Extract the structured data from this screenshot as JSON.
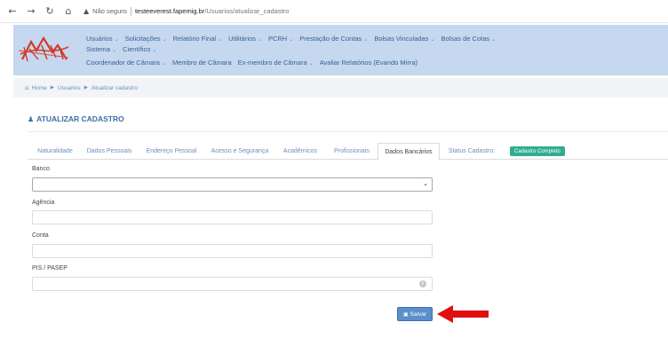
{
  "browser": {
    "back": "←",
    "forward": "→",
    "reload": "↻",
    "home": "⌂",
    "warning": "▲",
    "security_label": "Não seguro",
    "url_host": "testeeverest.fapemig.br",
    "url_path": "/Usuarios/atualizar_cadastro"
  },
  "menu": {
    "row1": [
      "Usuários",
      "Solicitações",
      "Relatório Final",
      "Utilitários",
      "PCRH",
      "Prestação de Contas",
      "Bolsas Vinculadas",
      "Bolsas de Cotas"
    ],
    "row2": [
      "Sistema",
      "Científico"
    ],
    "row3": [
      "Coordenador de Câmara",
      "Membro de Câmara",
      "Ex-membro de Câmara",
      "Avaliar Relatórios (Evando Mirra)"
    ],
    "chevron": "⌄"
  },
  "breadcrumb": {
    "home": "Home",
    "usuarios": "Usuarios",
    "current": "Atualizar cadastro",
    "sep": "▶"
  },
  "page": {
    "title": "ATUALIZAR CADASTRO"
  },
  "tabs": {
    "naturalidade": "Naturalidade",
    "dados_pessoais": "Dados Pessoais",
    "endereco": "Endereço Pessoal",
    "acesso": "Acesso e Segurança",
    "academicos": "Acadêmicos",
    "profissionais": "Profissionais",
    "bancarios": "Dados Bancários",
    "status": "Status Cadastro:",
    "badge": "Cadastro Completo"
  },
  "form": {
    "banco_label": "Banco",
    "agencia_label": "Agência",
    "conta_label": "Conta",
    "pis_label": "PIS / PASEP",
    "select_chevron": "⌄",
    "info_icon": "i"
  },
  "actions": {
    "save_label": "Salvar",
    "save_icon": "▣"
  },
  "colors": {
    "header_bg": "#c5d8f0",
    "accent": "#3a6ea5",
    "badge": "#2fae8f",
    "save_button": "#5b8fcb",
    "arrow": "#e01010"
  }
}
